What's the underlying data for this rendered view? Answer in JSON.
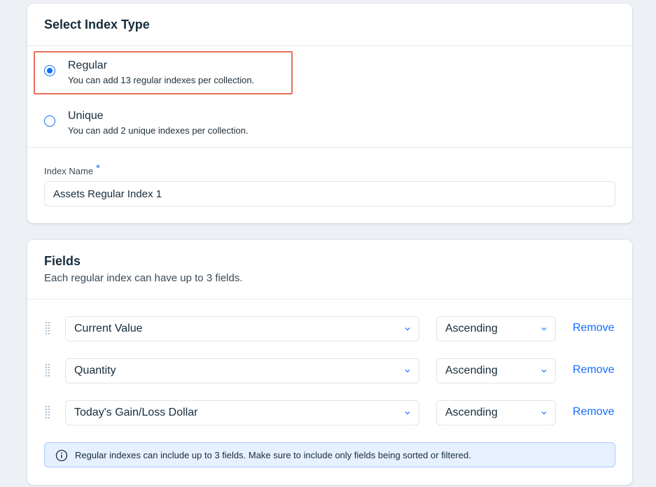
{
  "index_type": {
    "title": "Select Index Type",
    "options": [
      {
        "label": "Regular",
        "description": "You can add 13 regular indexes per collection.",
        "selected": true
      },
      {
        "label": "Unique",
        "description": "You can add 2 unique indexes per collection.",
        "selected": false
      }
    ],
    "index_name_label": "Index Name",
    "required_mark": "*",
    "index_name_value": "Assets Regular Index 1"
  },
  "fields": {
    "title": "Fields",
    "subtitle": "Each regular index can have up to 3 fields.",
    "rows": [
      {
        "field": "Current Value",
        "order": "Ascending",
        "remove_label": "Remove"
      },
      {
        "field": "Quantity",
        "order": "Ascending",
        "remove_label": "Remove"
      },
      {
        "field": "Today's Gain/Loss Dollar",
        "order": "Ascending",
        "remove_label": "Remove"
      }
    ],
    "info_text": "Regular indexes can include up to 3 fields. Make sure to include only fields being sorted or filtered."
  },
  "colors": {
    "accent": "#116dff",
    "highlight_border": "#e8705a",
    "info_background": "#e7f0ff",
    "page_background": "#edf0f5"
  },
  "icons": {
    "drag_handle": "drag-handle-icon",
    "chevron": "chevron-down-icon",
    "info": "info-icon"
  }
}
